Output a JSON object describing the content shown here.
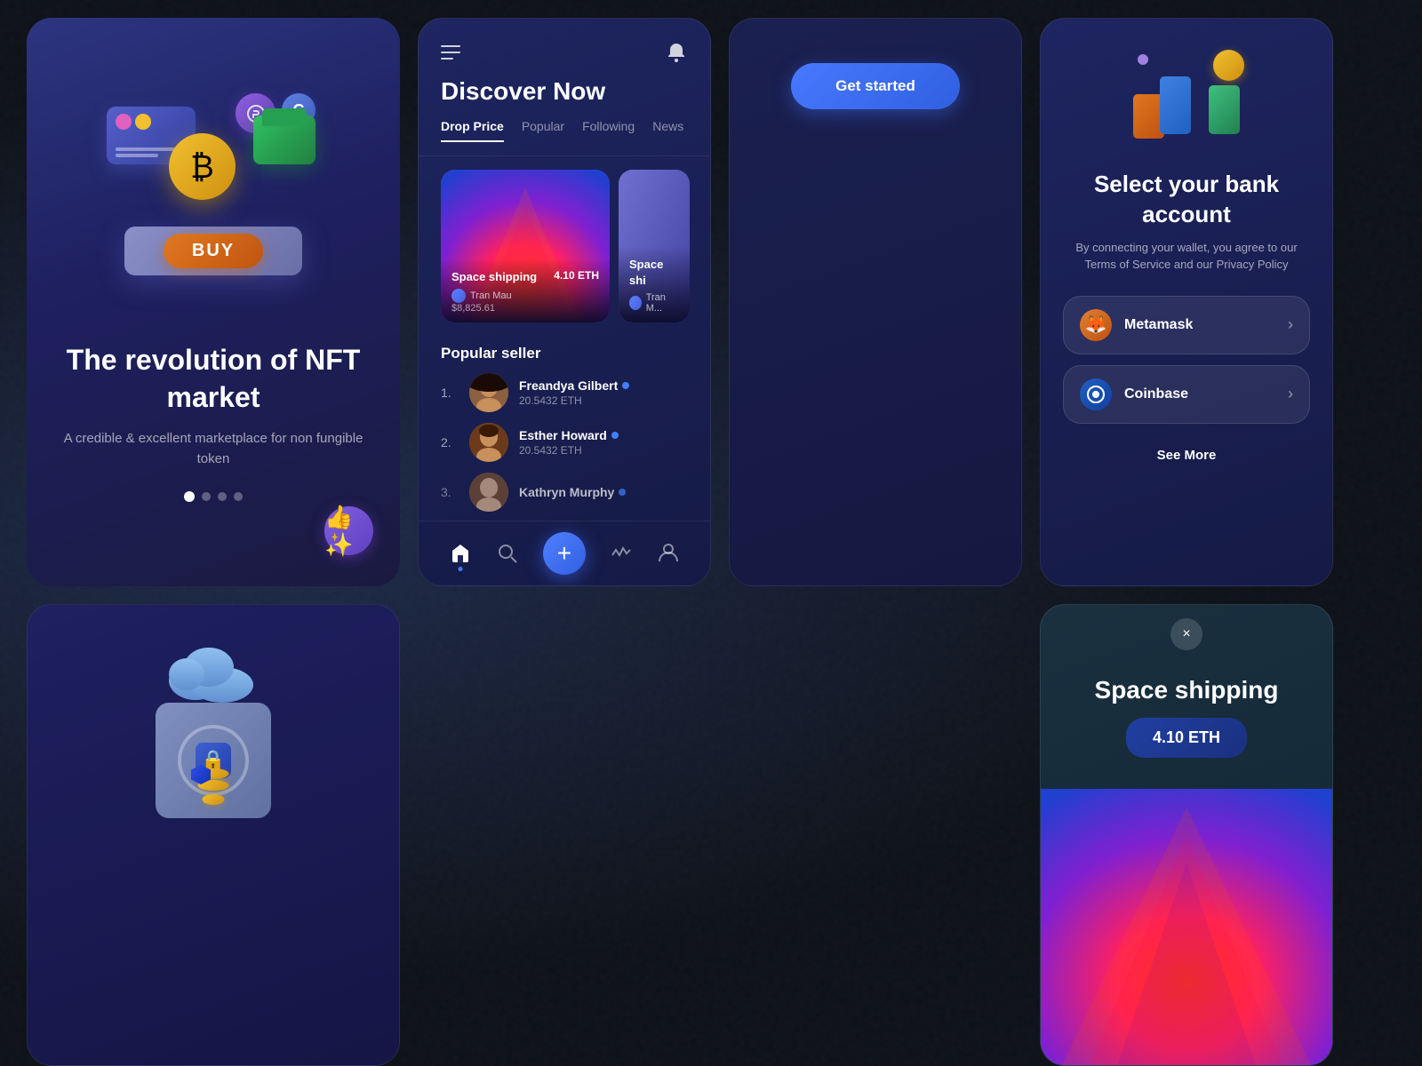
{
  "cards": {
    "nft_market": {
      "title": "The revolution of NFT market",
      "subtitle": "A credible & excellent marketplace\nfor non fungible token",
      "buy_label": "BUY",
      "pagination": [
        "active",
        "inactive",
        "inactive",
        "inactive"
      ]
    },
    "discover": {
      "title": "Discover Now",
      "tabs": [
        "Drop Price",
        "Popular",
        "Following",
        "News"
      ],
      "active_tab": "Drop Price",
      "nft_cards": [
        {
          "title": "Space shipping",
          "price": "4.10 ETH",
          "usd_price": "$8,825.61",
          "creator": "Tran Mau"
        },
        {
          "title": "Space shi...",
          "creator": "Tran M..."
        }
      ],
      "popular_seller_title": "Popular seller",
      "sellers": [
        {
          "rank": "1.",
          "name": "Freandya Gilbert",
          "eth": "20.5432 ETH",
          "verified": true
        },
        {
          "rank": "2.",
          "name": "Esther Howard",
          "eth": "20.5432 ETH",
          "verified": true
        },
        {
          "rank": "3.",
          "name": "Kathryn Murphy",
          "eth": "",
          "verified": true
        }
      ],
      "nav_items": [
        "home",
        "search",
        "add",
        "activity",
        "profile"
      ]
    },
    "get_started": {
      "button_label": "Get started"
    },
    "bank_account": {
      "title": "Select your bank account",
      "subtitle": "By connecting your wallet, you agree to our Terms of Service and our Privacy Policy",
      "wallets": [
        {
          "name": "Metamask",
          "icon": "🦊"
        },
        {
          "name": "Coinbase",
          "icon": "💠"
        }
      ],
      "see_more": "See More"
    },
    "space_detail": {
      "title": "Space shipping",
      "price": "4.10 ETH",
      "close_icon": "×"
    }
  }
}
